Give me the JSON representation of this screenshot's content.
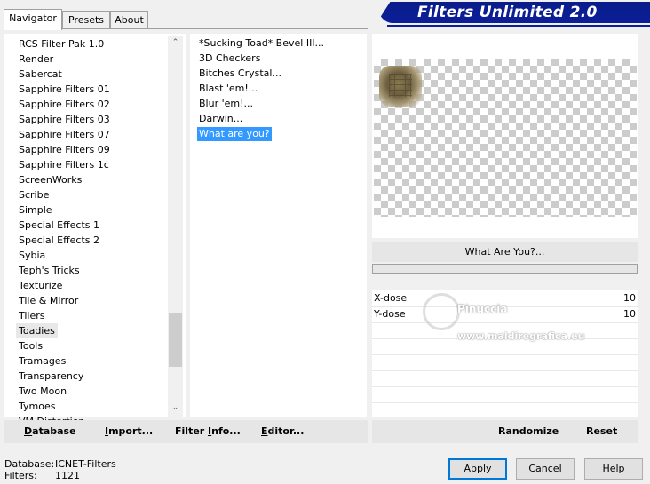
{
  "header": {
    "title": "Filters Unlimited 2.0"
  },
  "tabs": [
    {
      "label": "Navigator",
      "active": true
    },
    {
      "label": "Presets",
      "active": false
    },
    {
      "label": "About",
      "active": false
    }
  ],
  "categories": {
    "items": [
      "RCS Filter Pak 1.0",
      "Render",
      "Sabercat",
      "Sapphire Filters 01",
      "Sapphire Filters 02",
      "Sapphire Filters 03",
      "Sapphire Filters 07",
      "Sapphire Filters 09",
      "Sapphire Filters 1c",
      "ScreenWorks",
      "Scribe",
      "Simple",
      "Special Effects 1",
      "Special Effects 2",
      "Sybia",
      "Teph's Tricks",
      "Texturize",
      "Tile & Mirror",
      "Tilers",
      "Toadies",
      "Tools",
      "Tramages",
      "Transparency",
      "Two Moon",
      "Tymoes",
      "VM Distortion"
    ],
    "selected": "Toadies"
  },
  "filters": {
    "items": [
      "*Sucking Toad*  Bevel III...",
      "3D Checkers",
      "Bitches Crystal...",
      "Blast 'em!...",
      "Blur 'em!...",
      "Darwin...",
      "What are you?"
    ],
    "selected": "What are you?"
  },
  "preview": {
    "filter_name": "What Are You?..."
  },
  "params": [
    {
      "label": "X-dose",
      "value": "10"
    },
    {
      "label": "Y-dose",
      "value": "10"
    }
  ],
  "watermark": {
    "line1": "Pinuccia",
    "line2": "www.maldiregrafica.eu"
  },
  "actions_left": [
    {
      "key": "D",
      "rest": "atabase"
    },
    {
      "key": "I",
      "rest": "mport..."
    },
    {
      "key": "",
      "pre": "Filter ",
      "mid": "I",
      "rest": "nfo..."
    },
    {
      "key": "E",
      "rest": "ditor..."
    }
  ],
  "actions_right": {
    "randomize": "Randomize",
    "reset": "Reset"
  },
  "status": {
    "database_label": "Database:",
    "database_value": "ICNET-Filters",
    "filters_label": "Filters:",
    "filters_value": "1121"
  },
  "buttons": {
    "apply": "Apply",
    "cancel": "Cancel",
    "help": "Help"
  },
  "colors": {
    "banner": "#0b1f9a",
    "selection": "#3399ff"
  }
}
